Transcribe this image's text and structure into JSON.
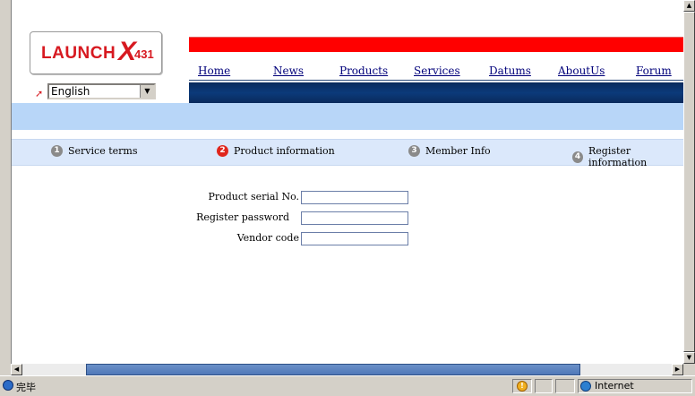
{
  "logo": {
    "brand": "LAUNCH",
    "mark": "X",
    "model": "431"
  },
  "language": {
    "selected": "English"
  },
  "nav": {
    "items": [
      "Home",
      "News",
      "Products",
      "Services",
      "Datums",
      "AboutUs",
      "Forum"
    ]
  },
  "steps": [
    {
      "num": "1",
      "label": "Service terms"
    },
    {
      "num": "2",
      "label": "Product information"
    },
    {
      "num": "3",
      "label": "Member Info"
    },
    {
      "num": "4",
      "label": "Register information"
    }
  ],
  "form": {
    "serial_label": "Product serial No.",
    "password_label": "Register password",
    "vendor_label": "Vendor code",
    "serial_value": "",
    "password_value": "",
    "vendor_value": ""
  },
  "status": {
    "text": "完毕",
    "zone": "Internet"
  },
  "colors": {
    "brand_red": "#d71920",
    "nav_blue": "#0b3a7a",
    "band_light": "#b8d6f8",
    "step_band": "#dbe8fb"
  }
}
